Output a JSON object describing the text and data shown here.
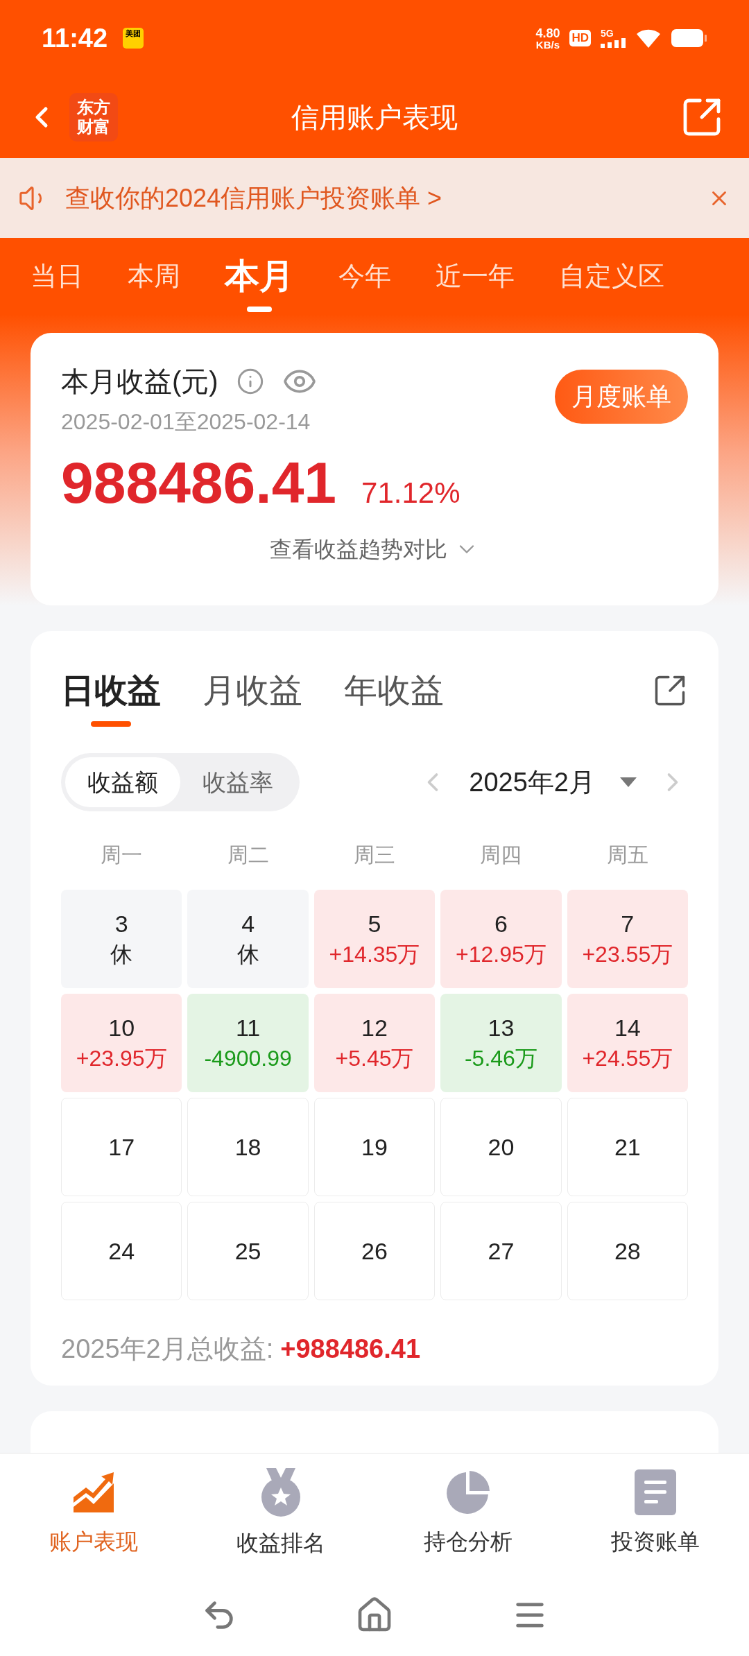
{
  "status_bar": {
    "time": "11:42",
    "app_badge": "美团",
    "net_speed": "4.80",
    "net_unit": "KB/s",
    "hd": "HD",
    "network": "5G"
  },
  "header": {
    "logo": [
      "东方",
      "财富"
    ],
    "title": "信用账户表现"
  },
  "banner": {
    "text": "查收你的2024信用账户投资账单 >"
  },
  "period_tabs": [
    {
      "label": "当日",
      "selected": false
    },
    {
      "label": "本周",
      "selected": false
    },
    {
      "label": "本月",
      "selected": true
    },
    {
      "label": "今年",
      "selected": false
    },
    {
      "label": "近一年",
      "selected": false
    },
    {
      "label": "自定义区",
      "selected": false
    }
  ],
  "summary": {
    "title": "本月收益(元)",
    "date_range": "2025-02-01至2025-02-14",
    "bill_button": "月度账单",
    "amount": "988486.41",
    "rate": "71.12%",
    "trend_link": "查看收益趋势对比"
  },
  "calendar": {
    "tabs": [
      {
        "label": "日收益",
        "selected": true
      },
      {
        "label": "月收益",
        "selected": false
      },
      {
        "label": "年收益",
        "selected": false
      }
    ],
    "toggle": [
      {
        "label": "收益额",
        "selected": true
      },
      {
        "label": "收益率",
        "selected": false
      }
    ],
    "month": "2025年2月",
    "weekdays": [
      "周一",
      "周二",
      "周三",
      "周四",
      "周五"
    ],
    "days": [
      {
        "day": "3",
        "value": "休",
        "kind": "rest"
      },
      {
        "day": "4",
        "value": "休",
        "kind": "rest"
      },
      {
        "day": "5",
        "value": "+14.35万",
        "kind": "gain"
      },
      {
        "day": "6",
        "value": "+12.95万",
        "kind": "gain"
      },
      {
        "day": "7",
        "value": "+23.55万",
        "kind": "gain"
      },
      {
        "day": "10",
        "value": "+23.95万",
        "kind": "gain"
      },
      {
        "day": "11",
        "value": "-4900.99",
        "kind": "loss"
      },
      {
        "day": "12",
        "value": "+5.45万",
        "kind": "gain"
      },
      {
        "day": "13",
        "value": "-5.46万",
        "kind": "loss"
      },
      {
        "day": "14",
        "value": "+24.55万",
        "kind": "gain"
      },
      {
        "day": "17",
        "kind": "empty"
      },
      {
        "day": "18",
        "kind": "empty"
      },
      {
        "day": "19",
        "kind": "empty"
      },
      {
        "day": "20",
        "kind": "empty"
      },
      {
        "day": "21",
        "kind": "empty"
      },
      {
        "day": "24",
        "kind": "empty"
      },
      {
        "day": "25",
        "kind": "empty"
      },
      {
        "day": "26",
        "kind": "empty"
      },
      {
        "day": "27",
        "kind": "empty"
      },
      {
        "day": "28",
        "kind": "empty"
      }
    ],
    "total_label": "2025年2月总收益:",
    "total_value": "+988486.41"
  },
  "bottom_tabs": [
    {
      "label": "账户表现",
      "selected": true,
      "kind": "chart"
    },
    {
      "label": "收益排名",
      "selected": false,
      "kind": "medal"
    },
    {
      "label": "持仓分析",
      "selected": false,
      "kind": "pie"
    },
    {
      "label": "投资账单",
      "selected": false,
      "kind": "document"
    }
  ]
}
